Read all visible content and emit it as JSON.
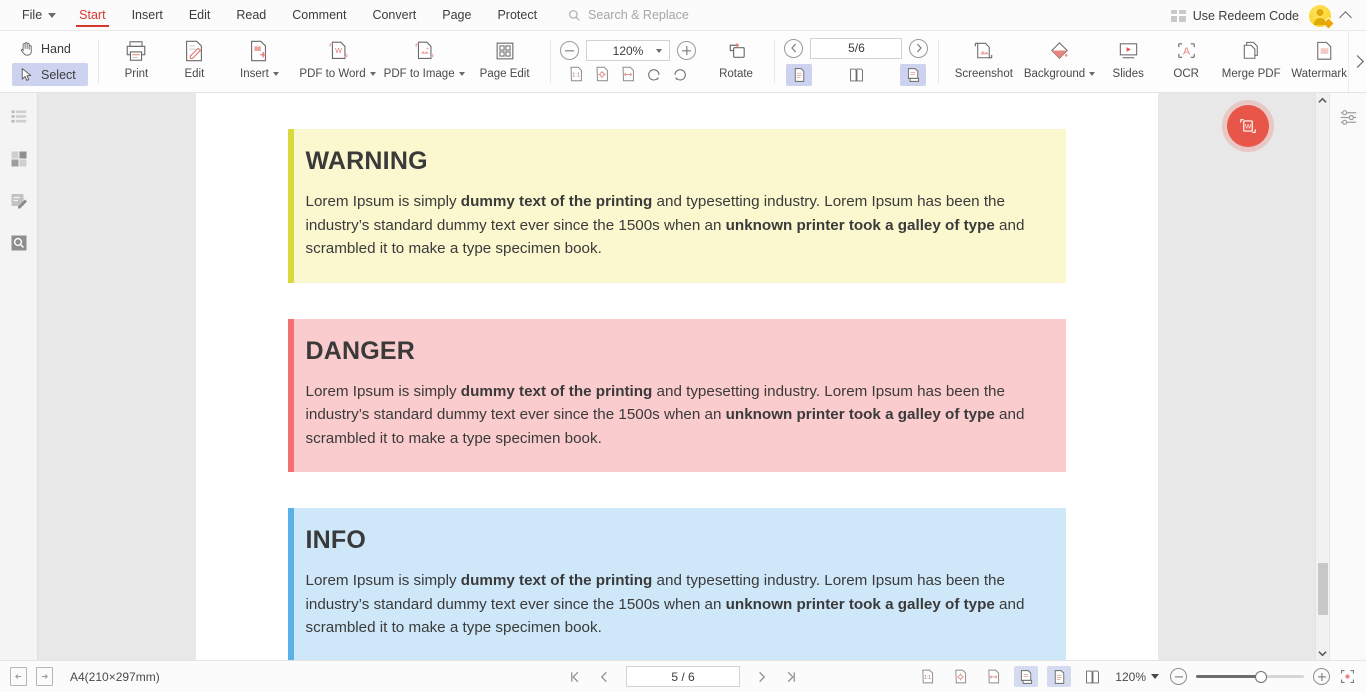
{
  "menubar": {
    "items": [
      {
        "label": "File",
        "icon": "caret-down-icon",
        "active": false
      },
      {
        "label": "Start",
        "active": true
      },
      {
        "label": "Insert",
        "active": false
      },
      {
        "label": "Edit",
        "active": false
      },
      {
        "label": "Read",
        "active": false
      },
      {
        "label": "Comment",
        "active": false
      },
      {
        "label": "Convert",
        "active": false
      },
      {
        "label": "Page",
        "active": false
      },
      {
        "label": "Protect",
        "active": false
      }
    ],
    "search_placeholder": "Search & Replace",
    "redeem_label": "Use Redeem Code",
    "redeem_icon": "gift-icon",
    "avatar_icon": "user-avatar-icon",
    "collapse_icon": "chevron-up-icon"
  },
  "ribbon": {
    "hand_label": "Hand",
    "select_label": "Select",
    "tools": [
      {
        "label": "Print",
        "icon": "printer-icon",
        "caret": false
      },
      {
        "label": "Edit",
        "icon": "edit-document-icon",
        "caret": false
      },
      {
        "label": "Insert",
        "icon": "insert-page-icon",
        "caret": true
      },
      {
        "label": "PDF to Word",
        "icon": "pdf-to-word-icon",
        "caret": true
      },
      {
        "label": "PDF to Image",
        "icon": "pdf-to-image-icon",
        "caret": true
      },
      {
        "label": "Page Edit",
        "icon": "page-edit-icon",
        "caret": false
      }
    ],
    "zoom_value": "120%",
    "zoom_out_icon": "zoom-out-icon",
    "zoom_in_icon": "zoom-in-icon",
    "fit_icons": [
      {
        "name": "actual-size-icon"
      },
      {
        "name": "fit-page-icon"
      },
      {
        "name": "fit-width-icon"
      },
      {
        "name": "rotate-left-icon"
      },
      {
        "name": "rotate-right-icon"
      }
    ],
    "rotate_label": "Rotate",
    "rotate_icon": "rotate-pages-icon",
    "page_value": "5/6",
    "prev_page_icon": "chevron-left-circle-icon",
    "next_page_icon": "chevron-right-circle-icon",
    "view_modes": [
      {
        "name": "single-page-view-icon",
        "selected": true
      },
      {
        "name": "two-page-view-icon",
        "selected": false
      },
      {
        "name": "continuous-scroll-view-icon",
        "selected": true
      }
    ],
    "right_tools": [
      {
        "label": "Screenshot",
        "icon": "screenshot-icon",
        "caret": false
      },
      {
        "label": "Background",
        "icon": "background-icon",
        "caret": true
      },
      {
        "label": "Slides",
        "icon": "slides-icon",
        "caret": false
      },
      {
        "label": "OCR",
        "icon": "ocr-icon",
        "caret": false
      },
      {
        "label": "Merge PDF",
        "icon": "merge-pdf-icon",
        "caret": false
      },
      {
        "label": "Watermark",
        "icon": "watermark-icon",
        "caret": true
      }
    ],
    "overflow_icon": "chevron-right-icon"
  },
  "left_rail": [
    {
      "name": "bookmarks-panel-icon"
    },
    {
      "name": "thumbnails-panel-icon"
    },
    {
      "name": "annotations-panel-icon"
    },
    {
      "name": "search-panel-icon"
    }
  ],
  "right_rail": [
    {
      "name": "settings-sliders-icon"
    }
  ],
  "fab": {
    "icon": "pdf-to-word-fab-icon"
  },
  "document": {
    "callouts": [
      {
        "title": "WARNING",
        "bg": "#fbf8d0",
        "bar": "#d8d83f",
        "paragraph": [
          {
            "text": "Lorem Ipsum is simply ",
            "bold": false
          },
          {
            "text": "dummy text of the printing",
            "bold": true
          },
          {
            "text": " and typesetting industry. Lorem Ipsum has been the industry’s standard dummy text ever since the 1500s when an ",
            "bold": false
          },
          {
            "text": "unknown printer took a galley of type",
            "bold": true
          },
          {
            "text": " and scrambled it to make a type specimen book.",
            "bold": false
          }
        ]
      },
      {
        "title": "DANGER",
        "bg": "#fbccce",
        "bar": "#f2706f",
        "paragraph": [
          {
            "text": "Lorem Ipsum is simply ",
            "bold": false
          },
          {
            "text": "dummy text of the printing",
            "bold": true
          },
          {
            "text": " and typesetting industry. Lorem Ipsum has been the industry’s standard dummy text ever since the 1500s when an ",
            "bold": false
          },
          {
            "text": "unknown printer took a galley of type",
            "bold": true
          },
          {
            "text": " and scrambled it to make a type specimen book.",
            "bold": false
          }
        ]
      },
      {
        "title": "INFO",
        "bg": "#cfe8f9",
        "bar": "#5bb0ea",
        "paragraph": [
          {
            "text": "Lorem Ipsum is simply ",
            "bold": false
          },
          {
            "text": "dummy text of the printing",
            "bold": true
          },
          {
            "text": " and typesetting industry. Lorem Ipsum has been the industry’s standard dummy text ever since the 1500s when an ",
            "bold": false
          },
          {
            "text": "unknown printer took a galley of type",
            "bold": true
          },
          {
            "text": " and scrambled it to make a type specimen book.",
            "bold": false
          }
        ]
      }
    ]
  },
  "statusbar": {
    "prev_page_icon": "previous-page-icon",
    "next_page_icon": "next-page-icon",
    "page_size": "A4(210×297mm)",
    "first_icon": "first-page-icon",
    "prev_icon": "prev-page-icon",
    "page_value": "5 / 6",
    "next_icon": "next-page-arrow-icon",
    "last_icon": "last-page-icon",
    "view_icons": [
      {
        "name": "actual-size-icon",
        "selected": false
      },
      {
        "name": "fit-page-icon",
        "selected": false
      },
      {
        "name": "fit-width-icon",
        "selected": false
      },
      {
        "name": "continuous-view-icon",
        "selected": true
      },
      {
        "name": "single-page-view-icon",
        "selected": true
      },
      {
        "name": "two-page-view-icon",
        "selected": false
      }
    ],
    "zoom_label": "120%",
    "zoom_out_icon": "zoom-out-icon",
    "zoom_in_icon": "zoom-in-icon",
    "fullscreen_icon": "fullscreen-icon",
    "slider_percent": 60
  }
}
